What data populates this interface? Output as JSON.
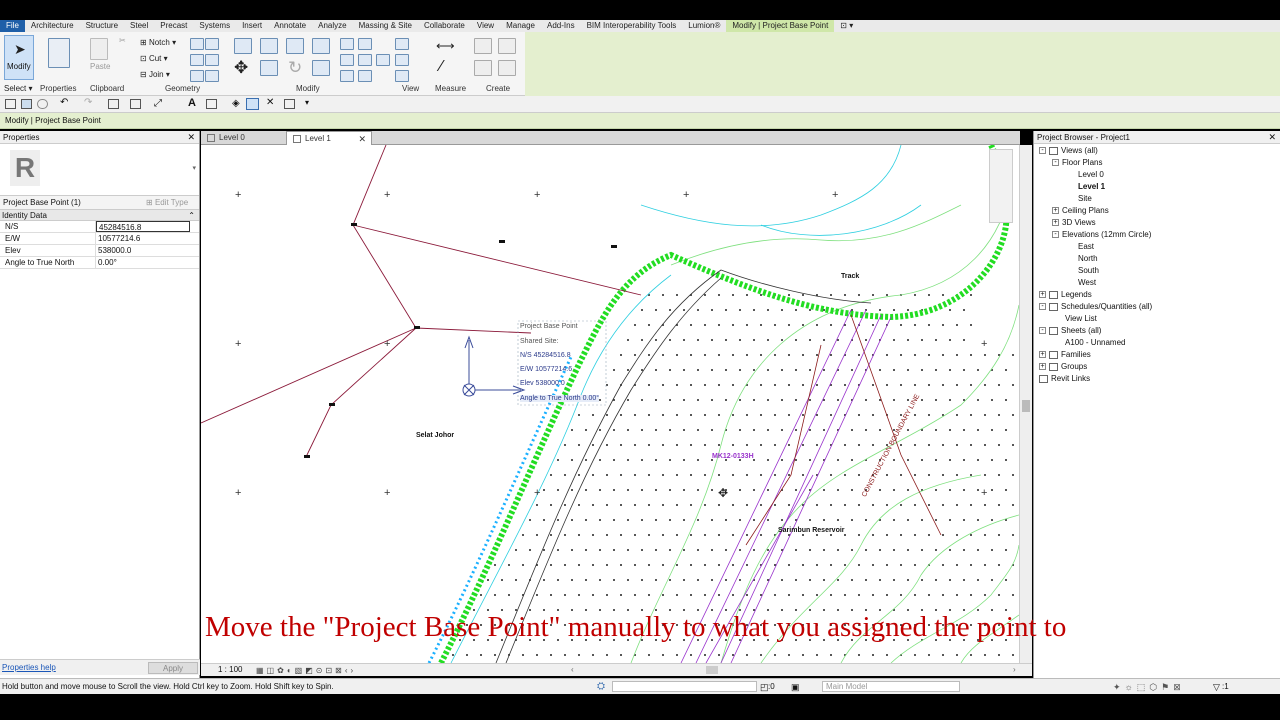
{
  "menu": {
    "tabs": [
      "File",
      "Architecture",
      "Structure",
      "Steel",
      "Precast",
      "Systems",
      "Insert",
      "Annotate",
      "Analyze",
      "Massing & Site",
      "Collaborate",
      "View",
      "Manage",
      "Add-Ins",
      "BIM Interoperability Tools",
      "Lumion®",
      "Modify | Project Base Point"
    ]
  },
  "ribbon": {
    "modify_label": "Modify",
    "select_label": "Select",
    "properties_label": "Properties",
    "paste_label": "Paste",
    "clipboard_label": "Clipboard",
    "notch_label": "Notch",
    "cut_label": "Cut",
    "join_label": "Join",
    "geometry_label": "Geometry",
    "modify_panel_label": "Modify",
    "view_label": "View",
    "measure_label": "Measure",
    "create_label": "Create"
  },
  "context": {
    "title": "Modify | Project Base Point"
  },
  "properties": {
    "title": "Properties",
    "logo": "R",
    "instance": "Project Base Point (1)",
    "edit_type": "Edit Type",
    "category": "Identity Data",
    "rows": [
      {
        "name": "N/S",
        "value": "45284516.8"
      },
      {
        "name": "E/W",
        "value": "10577214.6"
      },
      {
        "name": "Elev",
        "value": "538000.0"
      },
      {
        "name": "Angle to True North",
        "value": "0.00°"
      }
    ],
    "help": "Properties help",
    "apply": "Apply"
  },
  "view_tabs": [
    {
      "label": "Level 0"
    },
    {
      "label": "Level 1"
    }
  ],
  "canvas": {
    "pbp_title": "Project Base Point",
    "shared_site": "Shared Site:",
    "ns": "N/S   45284516.8",
    "ew": "E/W   10577214.6",
    "elev": "Elev   538000.0",
    "angle": "Angle to True North   0.00°",
    "selat": "Selat Johor",
    "reservoir": "Sarimbun Reservoir",
    "track": "Track",
    "boundary": "CONSTRUCTION BOUNDARY LINE",
    "mk": "MK12-0133H",
    "scale": "1 : 100"
  },
  "browser": {
    "title": "Project Browser - Project1",
    "items": [
      "Views (all)",
      "Floor Plans",
      "Level 0",
      "Level 1",
      "Site",
      "Ceiling Plans",
      "3D Views",
      "Elevations (12mm Circle)",
      "East",
      "North",
      "South",
      "West",
      "Legends",
      "Schedules/Quantities (all)",
      "View List",
      "Sheets (all)",
      "A100 - Unnamed",
      "Families",
      "Groups",
      "Revit Links"
    ]
  },
  "status": {
    "text": "Hold button and move mouse to Scroll the view. Hold Ctrl key to Zoom. Hold Shift key to Spin.",
    "coord": ":0",
    "model": "Main Model",
    "filter": ":1"
  },
  "caption": "Move the \"Project Base Point\" manually to what you assigned the point to",
  "colors": {
    "accent": "#1f5fa8",
    "context": "#e4efcf",
    "caption": "#c00000",
    "green": "#22dd22"
  }
}
